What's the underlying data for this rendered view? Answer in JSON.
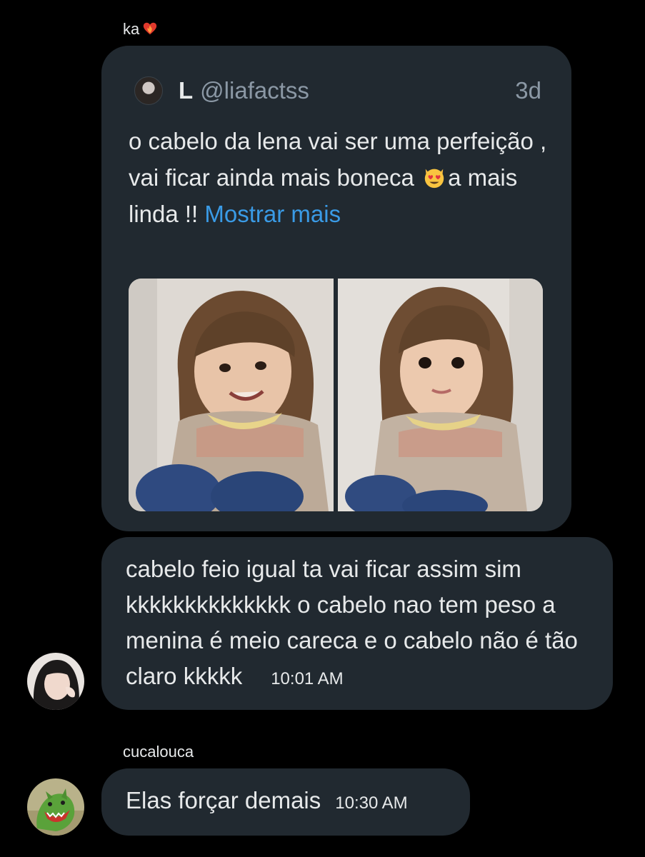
{
  "messages": [
    {
      "sender": "ka",
      "sender_badge_icon": "heart-on-fire-icon",
      "quoted_post": {
        "name": "L",
        "handle": "@liafactss",
        "age": "3d",
        "text_before_emoji": "o cabelo da lena vai ser uma perfeição , vai ficar ainda mais boneca ",
        "emoji_icon": "heart-eyes-cat-icon",
        "text_after_emoji": "a  mais  linda !! ",
        "show_more_label": "Mostrar mais",
        "show_more_color": "#3a9be6",
        "media_count": 2
      },
      "text": "cabelo feio igual ta vai ficar assim sim kkkkkkkkkkkkkk o cabelo nao tem peso a menina é meio careca e o cabelo não é tão claro kkkkk",
      "time": "10:01 AM"
    },
    {
      "sender": "cucalouca",
      "text": "Elas forçar demais",
      "time": "10:30 AM"
    }
  ],
  "colors": {
    "background": "#000000",
    "bubble": "#212930",
    "text": "#e7e9ea",
    "muted": "#8b98a5",
    "link": "#3a9be6"
  }
}
